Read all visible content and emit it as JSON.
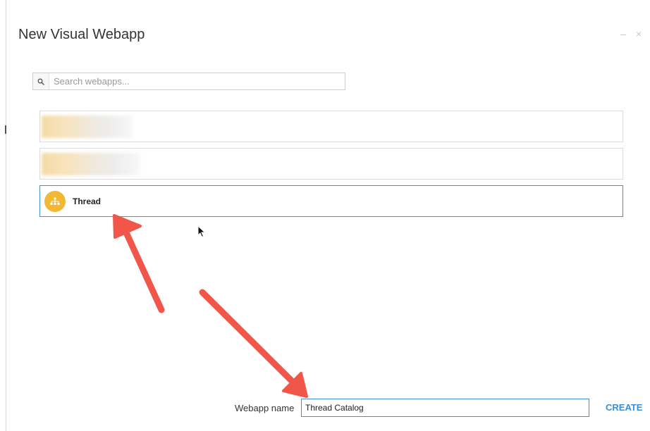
{
  "dialog": {
    "title": "New Visual Webapp",
    "minimize_glyph": "–",
    "close_glyph": "×"
  },
  "search": {
    "placeholder": "Search webapps...",
    "value": "",
    "icon": "search-icon"
  },
  "webapps": [
    {
      "label": "",
      "blurred": true,
      "selected": false
    },
    {
      "label": "",
      "blurred": true,
      "selected": false
    },
    {
      "label": "Thread",
      "icon": "sitemap-icon",
      "selected": true
    }
  ],
  "footer": {
    "name_label": "Webapp name",
    "name_value": "Thread Catalog",
    "create_label": "CREATE"
  },
  "colors": {
    "accent": "#3b8fd0",
    "selected_border": "#4a90c8",
    "icon_bg": "#f2b733",
    "annotation_arrow": "#f0574a"
  }
}
